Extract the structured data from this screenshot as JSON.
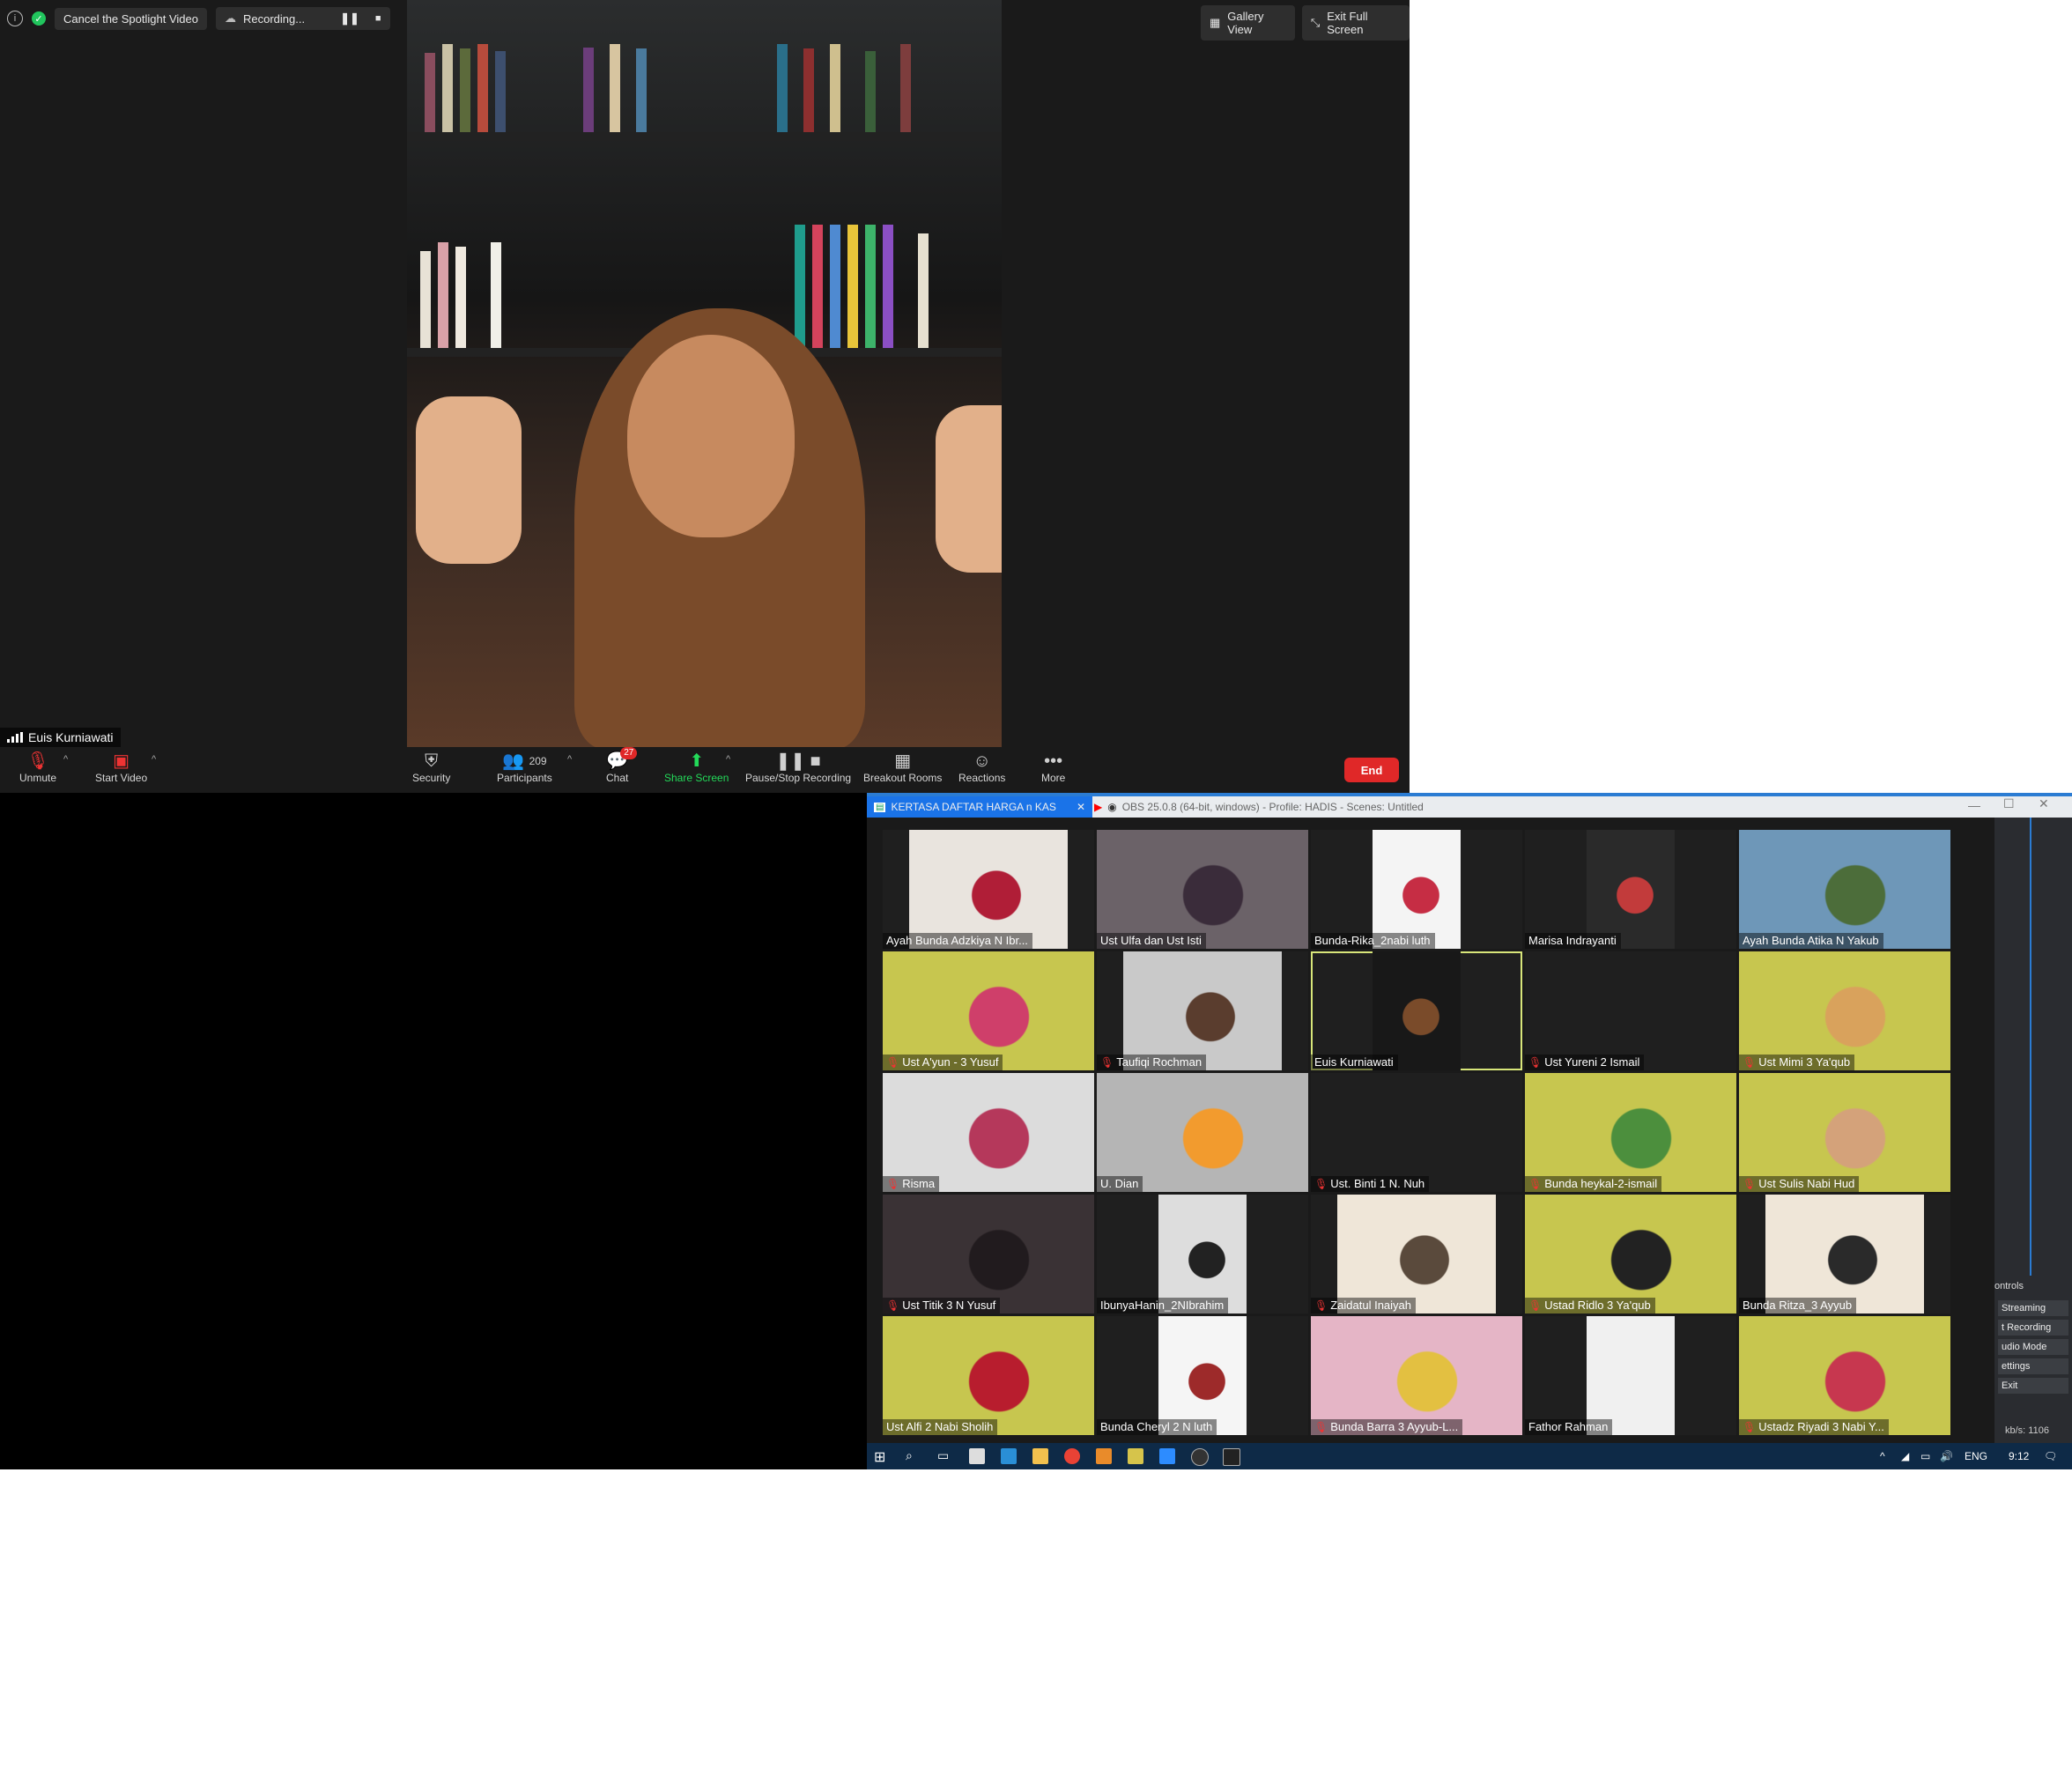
{
  "zoom": {
    "top_left": {
      "cancel_spotlight_label": "Cancel the Spotlight Video",
      "recording_label": "Recording..."
    },
    "top_right": {
      "gallery_view_label": "Gallery View",
      "exit_fullscreen_label": "Exit Full Screen"
    },
    "spotlight_name": "Euis Kurniawati",
    "toolbar": {
      "unmute": "Unmute",
      "start_video": "Start Video",
      "security": "Security",
      "participants": "Participants",
      "participants_count": "209",
      "chat": "Chat",
      "chat_badge": "27",
      "share_screen": "Share Screen",
      "pause_stop_recording": "Pause/Stop Recording",
      "breakout_rooms": "Breakout Rooms",
      "reactions": "Reactions",
      "more": "More",
      "end": "End"
    }
  },
  "browser_tabs": {
    "tab1": "KERTASA DAFTAR HARGA n KAS",
    "tab2": "OBS 25.0.8 (64-bit, windows) - Profile: HADIS - Scenes: Untitled"
  },
  "gallery": {
    "tiles": [
      {
        "name": "Ayah Bunda Adzkiya N Ibr...",
        "muted": false
      },
      {
        "name": "Ust Ulfa dan Ust Isti",
        "muted": false
      },
      {
        "name": "Bunda-Rika_2nabi luth",
        "muted": false
      },
      {
        "name": "Marisa Indrayanti",
        "muted": false
      },
      {
        "name": "Ayah Bunda Atika N Yakub",
        "muted": false
      },
      {
        "name": "Ust A'yun - 3 Yusuf",
        "muted": true
      },
      {
        "name": "Taufiqi Rochman",
        "muted": true
      },
      {
        "name": "Euis Kurniawati",
        "muted": false
      },
      {
        "name": "Ust Yureni 2 Ismail",
        "muted": true
      },
      {
        "name": "Ust Mimi 3 Ya'qub",
        "muted": true
      },
      {
        "name": "Risma",
        "muted": true
      },
      {
        "name": "U. Dian",
        "muted": false
      },
      {
        "name": "Ust. Binti 1 N. Nuh",
        "muted": true
      },
      {
        "name": "Bunda heykal-2-ismail",
        "muted": true
      },
      {
        "name": "Ust Sulis Nabi Hud",
        "muted": true
      },
      {
        "name": "Ust Titik 3 N Yusuf",
        "muted": true
      },
      {
        "name": "IbunyaHanin_2NIbrahim",
        "muted": false
      },
      {
        "name": "Zaidatul Inaiyah",
        "muted": true
      },
      {
        "name": "Ustad Ridlo 3 Ya'qub",
        "muted": true
      },
      {
        "name": "Bunda Ritza_3 Ayyub",
        "muted": false
      },
      {
        "name": "Ust Alfi 2 Nabi Sholih",
        "muted": false
      },
      {
        "name": "Bunda Cheryl 2 N luth",
        "muted": false
      },
      {
        "name": "Bunda Barra 3 Ayyub-L...",
        "muted": true
      },
      {
        "name": "Fathor Rahman",
        "muted": false
      },
      {
        "name": "Ustadz Riyadi 3 Nabi Y...",
        "muted": true
      }
    ]
  },
  "obs": {
    "dock_title": "ontrols",
    "buttons": [
      "Streaming",
      "t Recording",
      "udio Mode",
      "ettings",
      "Exit"
    ],
    "status": "kb/s: 1106"
  },
  "taskbar": {
    "lang": "ENG",
    "time": "9:12"
  },
  "colors": {
    "end_red": "#e02828",
    "share_green": "#23d959",
    "active_speaker_outline": "#d8e67a",
    "chat_badge_red": "#e02828"
  }
}
